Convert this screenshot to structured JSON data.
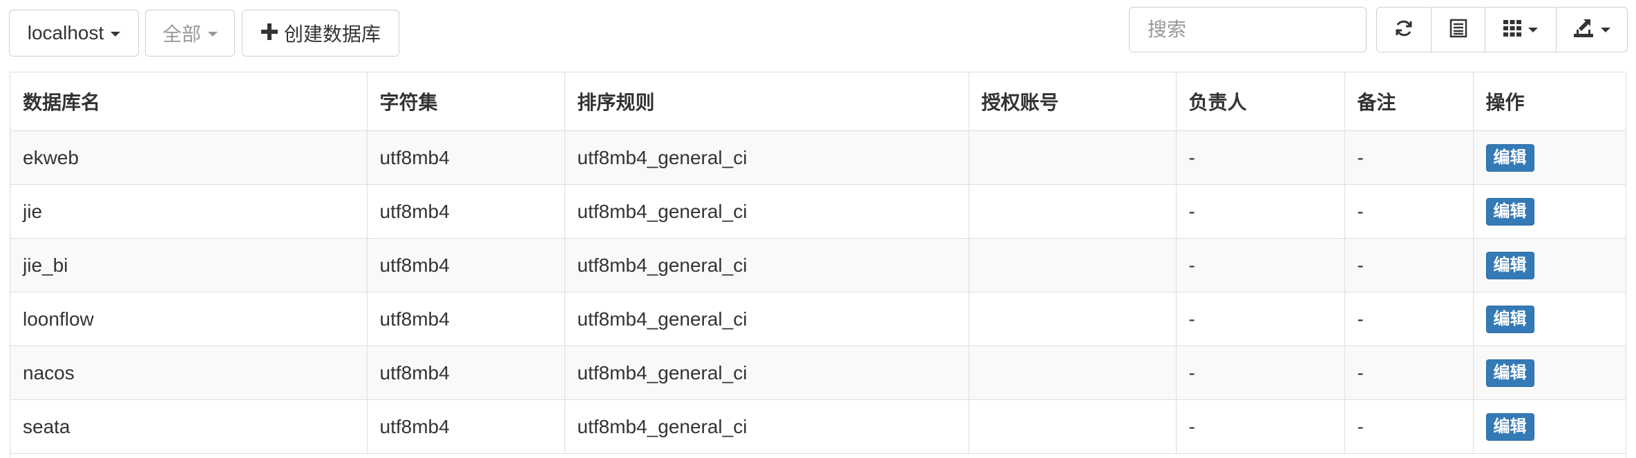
{
  "toolbar": {
    "host_label": "localhost",
    "filter_label": "全部",
    "create_label": "创建数据库",
    "search_placeholder": "搜索"
  },
  "icons": {
    "refresh": "refresh-icon",
    "toggle": "list-view-icon",
    "columns": "columns-grid-icon",
    "export": "export-icon",
    "create": "plus-icon"
  },
  "colors": {
    "edit_button": "#337ab7",
    "stripe": "#f9f9f9",
    "border": "#dddddd"
  },
  "table": {
    "headers": [
      "数据库名",
      "字符集",
      "排序规则",
      "授权账号",
      "负责人",
      "备注",
      "操作"
    ],
    "rows": [
      {
        "name": "ekweb",
        "charset": "utf8mb4",
        "collation": "utf8mb4_general_ci",
        "account": "",
        "owner": "-",
        "remark": "-",
        "action": "编辑"
      },
      {
        "name": "jie",
        "charset": "utf8mb4",
        "collation": "utf8mb4_general_ci",
        "account": "",
        "owner": "-",
        "remark": "-",
        "action": "编辑"
      },
      {
        "name": "jie_bi",
        "charset": "utf8mb4",
        "collation": "utf8mb4_general_ci",
        "account": "",
        "owner": "-",
        "remark": "-",
        "action": "编辑"
      },
      {
        "name": "loonflow",
        "charset": "utf8mb4",
        "collation": "utf8mb4_general_ci",
        "account": "",
        "owner": "-",
        "remark": "-",
        "action": "编辑"
      },
      {
        "name": "nacos",
        "charset": "utf8mb4",
        "collation": "utf8mb4_general_ci",
        "account": "",
        "owner": "-",
        "remark": "-",
        "action": "编辑"
      },
      {
        "name": "seata",
        "charset": "utf8mb4",
        "collation": "utf8mb4_general_ci",
        "account": "",
        "owner": "-",
        "remark": "-",
        "action": "编辑"
      }
    ]
  }
}
